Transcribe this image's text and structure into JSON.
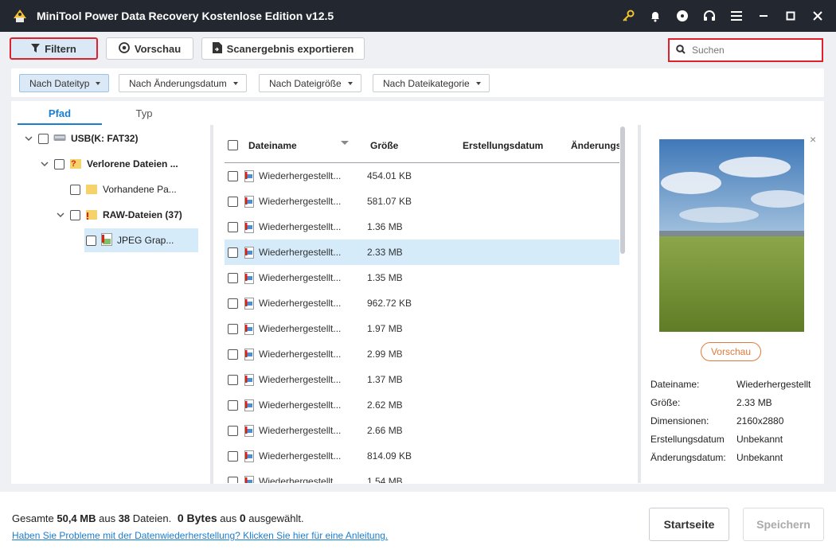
{
  "titlebar": {
    "title": "MiniTool Power Data Recovery Kostenlose Edition v12.5"
  },
  "toolbar": {
    "filter_label": "Filtern",
    "preview_label": "Vorschau",
    "export_label": "Scanergebnis exportieren"
  },
  "search": {
    "placeholder": "Suchen"
  },
  "filters": [
    "Nach Dateityp",
    "Nach Änderungsdatum",
    "Nach Dateigröße",
    "Nach Dateikategorie"
  ],
  "tabs": [
    "Pfad",
    "Typ"
  ],
  "tree": [
    {
      "label": "USB(K: FAT32)"
    },
    {
      "label": "Verlorene Dateien ..."
    },
    {
      "label": "Vorhandene Pa..."
    },
    {
      "label": "RAW-Dateien (37)"
    },
    {
      "label": "JPEG Grap..."
    }
  ],
  "list": {
    "columns": [
      "Dateiname",
      "Größe",
      "Erstellungsdatum",
      "Änderungs"
    ],
    "rows": [
      {
        "name": "Wiederhergestellt...",
        "size": "454.01 KB"
      },
      {
        "name": "Wiederhergestellt...",
        "size": "581.07 KB"
      },
      {
        "name": "Wiederhergestellt...",
        "size": "1.36 MB"
      },
      {
        "name": "Wiederhergestellt...",
        "size": "2.33 MB"
      },
      {
        "name": "Wiederhergestellt...",
        "size": "1.35 MB"
      },
      {
        "name": "Wiederhergestellt...",
        "size": "962.72 KB"
      },
      {
        "name": "Wiederhergestellt...",
        "size": "1.97 MB"
      },
      {
        "name": "Wiederhergestellt...",
        "size": "2.99 MB"
      },
      {
        "name": "Wiederhergestellt...",
        "size": "1.37 MB"
      },
      {
        "name": "Wiederhergestellt...",
        "size": "2.62 MB"
      },
      {
        "name": "Wiederhergestellt...",
        "size": "2.66 MB"
      },
      {
        "name": "Wiederhergestellt...",
        "size": "814.09 KB"
      },
      {
        "name": "Wiederhergestellt...",
        "size": "1.54 MB"
      }
    ]
  },
  "preview": {
    "button_label": "Vorschau",
    "info": [
      {
        "label": "Dateiname:",
        "value": "Wiederhergestellt"
      },
      {
        "label": "Größe:",
        "value": "2.33 MB"
      },
      {
        "label": "Dimensionen:",
        "value": "2160x2880"
      },
      {
        "label": "Erstellungsdatum",
        "value": "Unbekannt"
      },
      {
        "label": "Änderungsdatum:",
        "value": "Unbekannt"
      }
    ]
  },
  "footer": {
    "total_prefix": "Gesamte ",
    "total_size": "50,4 MB",
    "total_mid": " aus ",
    "total_count": "38",
    "total_suffix": " Dateien.",
    "sel_size": "0 Bytes",
    "sel_mid": " aus ",
    "sel_count": "0",
    "sel_suffix": " ausgewählt.",
    "help_link": "Haben Sie Probleme mit der Datenwiederherstellung? Klicken Sie hier für eine Anleitung.",
    "home_label": "Startseite",
    "save_label": "Speichern"
  },
  "colors": {
    "accent": "#1a7ed0",
    "highlight": "#e0202a",
    "titlebar": "#23272f",
    "selected_row": "#d6ebfa",
    "preview_button": "#e07a3a"
  }
}
